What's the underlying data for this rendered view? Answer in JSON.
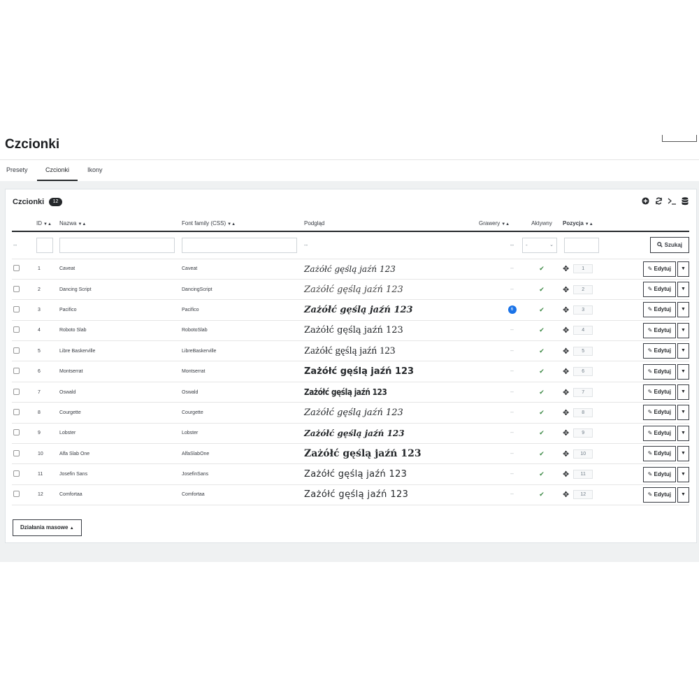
{
  "page": {
    "title": "Czcionki"
  },
  "tabs": [
    {
      "label": "Presety",
      "active": false
    },
    {
      "label": "Czcionki",
      "active": true
    },
    {
      "label": "Ikony",
      "active": false
    }
  ],
  "panel": {
    "title": "Czcionki",
    "count": "12"
  },
  "toolbar": {
    "icons": [
      "add-icon",
      "refresh-icon",
      "terminal-icon",
      "database-icon"
    ]
  },
  "table": {
    "headers": {
      "id": "ID",
      "name": "Nazwa",
      "font_family": "Font family (CSS)",
      "preview": "Podgląd",
      "engravings": "Grawery",
      "active": "Aktywny",
      "position": "Pozycja"
    },
    "filters": {
      "id_placeholder": "--",
      "preview_placeholder": "--",
      "engravings_placeholder": "--",
      "active_selected": "-",
      "search_label": "Szukaj"
    },
    "preview_text": "Zażółć gęślą jaźń 123",
    "edit_label": "Edytuj",
    "empty_value": "--",
    "rows": [
      {
        "id": "1",
        "name": "Caveat",
        "css": "Caveat",
        "engravings": "",
        "position": "1"
      },
      {
        "id": "2",
        "name": "Dancing Script",
        "css": "DancingScript",
        "engravings": "",
        "position": "2"
      },
      {
        "id": "3",
        "name": "Pacifico",
        "css": "Pacifico",
        "engravings": "6",
        "position": "3"
      },
      {
        "id": "4",
        "name": "Roboto Slab",
        "css": "RobotoSlab",
        "engravings": "",
        "position": "4"
      },
      {
        "id": "5",
        "name": "Libre Baskerville",
        "css": "LibreBaskerville",
        "engravings": "",
        "position": "5"
      },
      {
        "id": "6",
        "name": "Montserrat",
        "css": "Montserrat",
        "engravings": "",
        "position": "6"
      },
      {
        "id": "7",
        "name": "Oswald",
        "css": "Oswald",
        "engravings": "",
        "position": "7"
      },
      {
        "id": "8",
        "name": "Courgette",
        "css": "Courgette",
        "engravings": "",
        "position": "8"
      },
      {
        "id": "9",
        "name": "Lobster",
        "css": "Lobster",
        "engravings": "",
        "position": "9"
      },
      {
        "id": "10",
        "name": "Alfa Slab One",
        "css": "AlfaSlabOne",
        "engravings": "",
        "position": "10"
      },
      {
        "id": "11",
        "name": "Josefin Sans",
        "css": "JosefinSans",
        "engravings": "",
        "position": "11"
      },
      {
        "id": "12",
        "name": "Comfortaa",
        "css": "Comfortaa",
        "engravings": "",
        "position": "12"
      }
    ]
  },
  "bulk_actions": {
    "label": "Działania masowe"
  },
  "colors": {
    "primary_dark": "#25282b",
    "active_check": "#3f8a47",
    "badge_blue": "#1a73e8"
  }
}
